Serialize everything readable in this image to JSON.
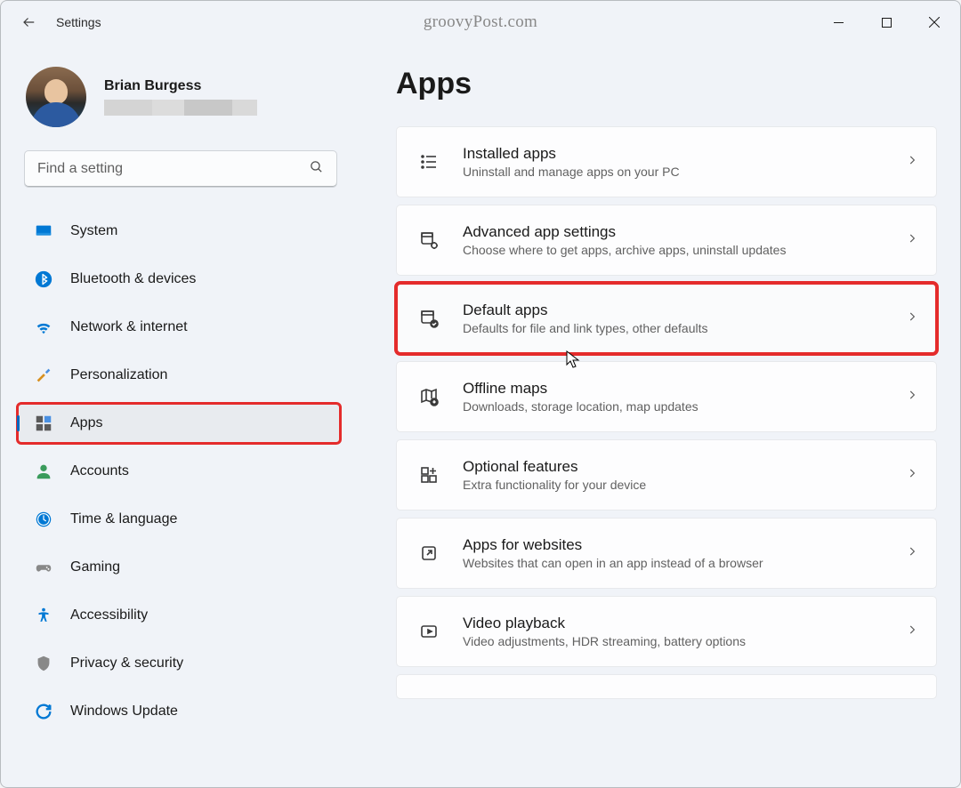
{
  "titlebar": {
    "title": "Settings",
    "watermark": "groovyPost.com"
  },
  "profile": {
    "name": "Brian Burgess"
  },
  "search": {
    "placeholder": "Find a setting"
  },
  "nav": [
    {
      "id": "system",
      "label": "System",
      "selected": false,
      "highlight": false
    },
    {
      "id": "bluetooth",
      "label": "Bluetooth & devices",
      "selected": false,
      "highlight": false
    },
    {
      "id": "network",
      "label": "Network & internet",
      "selected": false,
      "highlight": false
    },
    {
      "id": "personalization",
      "label": "Personalization",
      "selected": false,
      "highlight": false
    },
    {
      "id": "apps",
      "label": "Apps",
      "selected": true,
      "highlight": true
    },
    {
      "id": "accounts",
      "label": "Accounts",
      "selected": false,
      "highlight": false
    },
    {
      "id": "time",
      "label": "Time & language",
      "selected": false,
      "highlight": false
    },
    {
      "id": "gaming",
      "label": "Gaming",
      "selected": false,
      "highlight": false
    },
    {
      "id": "accessibility",
      "label": "Accessibility",
      "selected": false,
      "highlight": false
    },
    {
      "id": "privacy",
      "label": "Privacy & security",
      "selected": false,
      "highlight": false
    },
    {
      "id": "update",
      "label": "Windows Update",
      "selected": false,
      "highlight": false
    }
  ],
  "page": {
    "title": "Apps"
  },
  "cards": [
    {
      "id": "installed-apps",
      "title": "Installed apps",
      "sub": "Uninstall and manage apps on your PC",
      "highlight": false
    },
    {
      "id": "advanced-app-settings",
      "title": "Advanced app settings",
      "sub": "Choose where to get apps, archive apps, uninstall updates",
      "highlight": false
    },
    {
      "id": "default-apps",
      "title": "Default apps",
      "sub": "Defaults for file and link types, other defaults",
      "highlight": true
    },
    {
      "id": "offline-maps",
      "title": "Offline maps",
      "sub": "Downloads, storage location, map updates",
      "highlight": false
    },
    {
      "id": "optional-features",
      "title": "Optional features",
      "sub": "Extra functionality for your device",
      "highlight": false
    },
    {
      "id": "apps-for-websites",
      "title": "Apps for websites",
      "sub": "Websites that can open in an app instead of a browser",
      "highlight": false
    },
    {
      "id": "video-playback",
      "title": "Video playback",
      "sub": "Video adjustments, HDR streaming, battery options",
      "highlight": false
    }
  ]
}
